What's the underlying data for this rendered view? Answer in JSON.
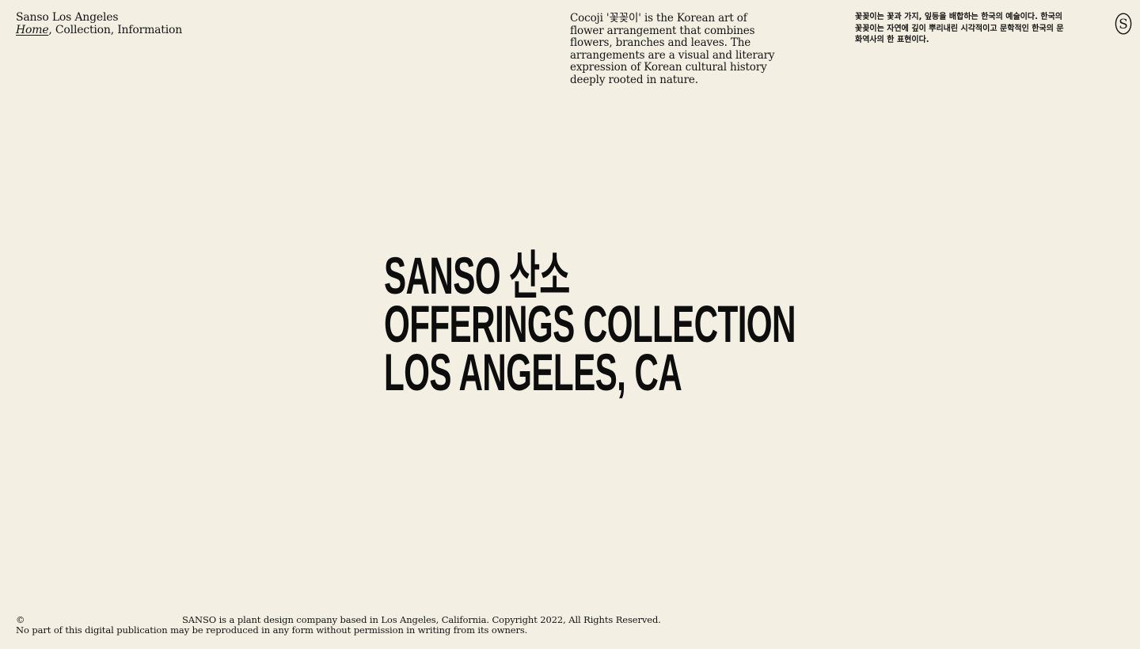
{
  "header": {
    "site_name": "Sanso Los Angeles",
    "nav": {
      "home": "Home",
      "sep1": ", ",
      "collection": "Collection",
      "sep2": ", ",
      "information": "Information"
    }
  },
  "intro": {
    "english": "Cocoji '꽃꽂이' is the Korean art of flower arrangement that combines flowers, branches and leaves. The arrangements are a visual and literary expression of Korean cultural history deeply rooted in nature.",
    "korean": "꽃꽂이는 꽃과 가지, 잎등을 배합하는 한국의 예술이다. 한국의 꽃꽂이는 자연에 깊이 뿌리내린 시각적이고 문학적인 한국의 문화역사의 한 표현이다."
  },
  "logo": {
    "letter": "S",
    "icon": "sanso-logo-icon"
  },
  "hero": {
    "line1": "SANSO 산소",
    "line2": "OFFERINGS COLLECTION",
    "line3": "LOS ANGELES, CA"
  },
  "footer": {
    "copyright_symbol": "©",
    "copyright_text": "SANSO is a plant design company based in Los Angeles, California. Copyright 2022, All Rights Reserved.",
    "notice": "No part of this digital publication may be reproduced in any form without permission in writing from its owners."
  },
  "colors": {
    "background": "#f3efe3",
    "text": "#141414"
  }
}
